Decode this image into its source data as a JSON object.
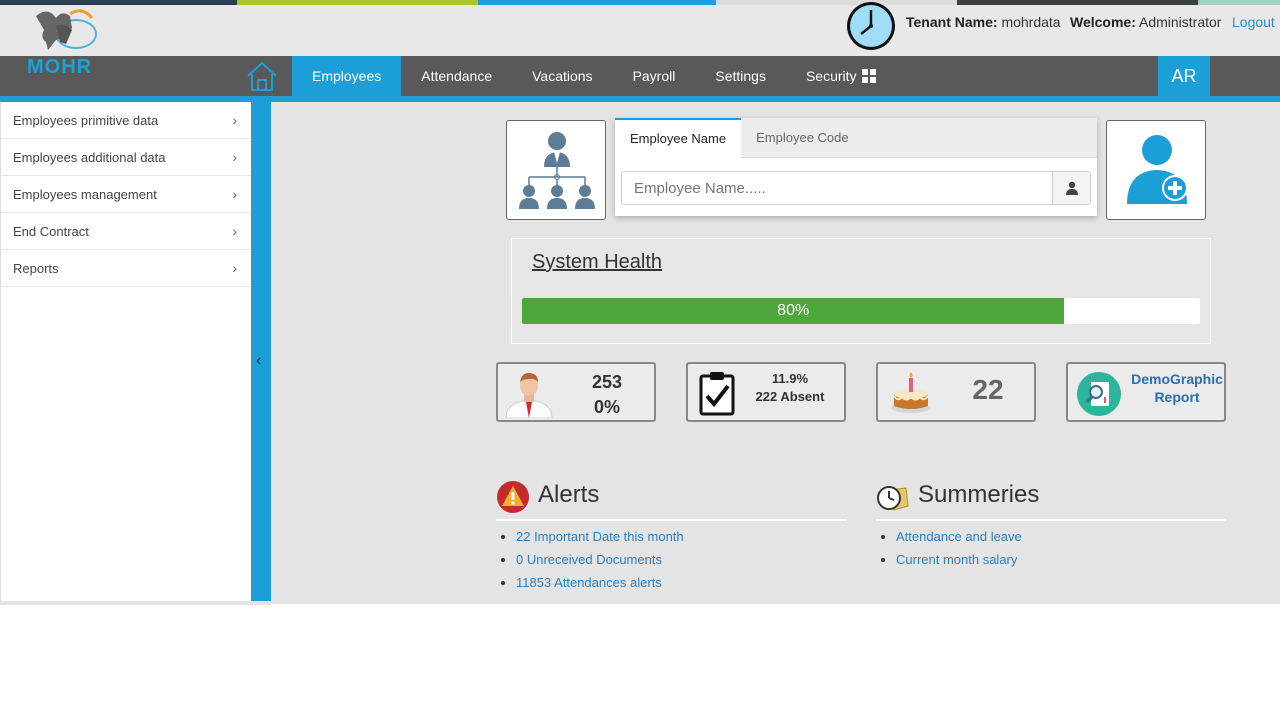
{
  "colors": {
    "accent": "#1b9fd6",
    "navbar": "#595959",
    "health_bar": "#4ea73b",
    "link": "#2a7fc4",
    "strip": [
      "#2c3e50",
      "#a8c628",
      "#1ba1d8",
      "#dcdcdc",
      "#3a3f44",
      "#9fd1c6"
    ]
  },
  "header": {
    "tenant_label": "Tenant Name:",
    "tenant_value": "mohrdata",
    "welcome_label": "Welcome:",
    "welcome_value": "Administrator",
    "logout": "Logout",
    "brand": "MOHR"
  },
  "nav": {
    "items": [
      "Employees",
      "Attendance",
      "Vacations",
      "Payroll",
      "Settings",
      "Security"
    ],
    "active": "Employees",
    "lang_button": "AR"
  },
  "sidebar": {
    "items": [
      "Employees primitive data",
      "Employees additional data",
      "Employees management",
      "End Contract",
      "Reports"
    ]
  },
  "search": {
    "tabs": [
      "Employee Name",
      "Employee Code"
    ],
    "active_tab": "Employee Name",
    "placeholder": "Employee Name....."
  },
  "health": {
    "title": "System Health",
    "percent": 80,
    "label": "80%"
  },
  "stats": {
    "employees_count": "253",
    "employees_percent": "0%",
    "absent_percent": "11.9%",
    "absent_count": "222 Absent",
    "birthdays": "22",
    "demographic_line1": "DemoGraphic",
    "demographic_line2": "Report"
  },
  "alerts": {
    "title": "Alerts",
    "items": [
      "22 Important Date this month",
      "0 Unreceived Documents",
      "11853 Attendances alerts"
    ]
  },
  "summeries": {
    "title": "Summeries",
    "items": [
      "Attendance and leave",
      "Current month salary"
    ]
  }
}
